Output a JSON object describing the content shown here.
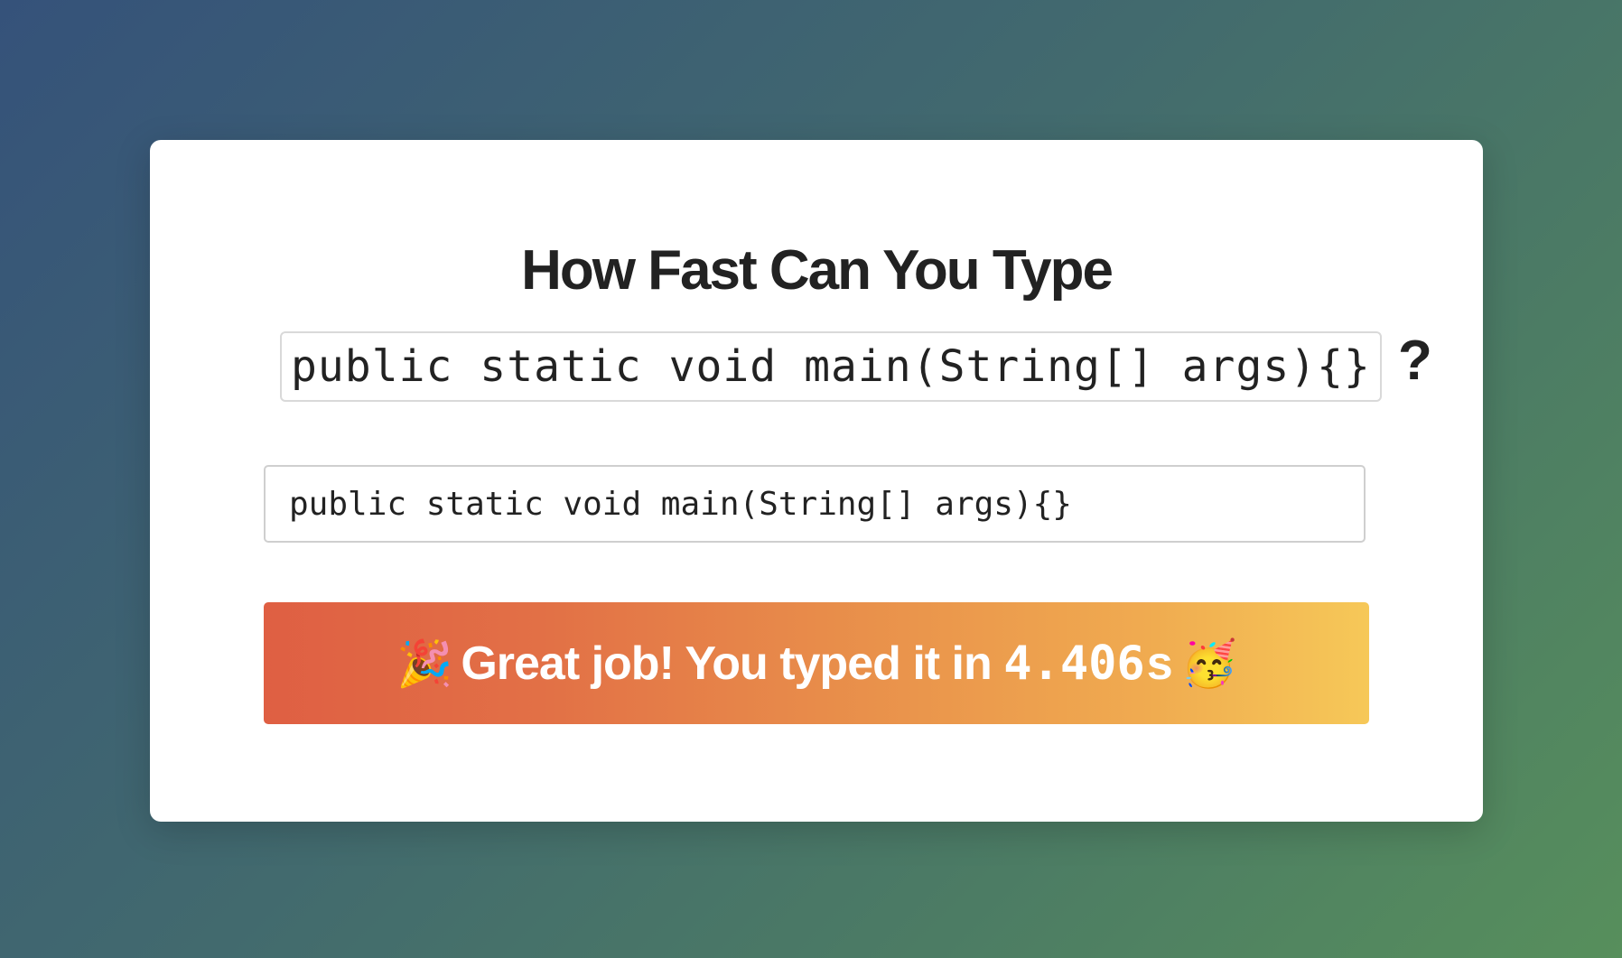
{
  "page": {
    "title": "How Fast Can You Type"
  },
  "challenge": {
    "target_text": "public static void main(String[] args){}",
    "question_mark": "?"
  },
  "input": {
    "value": "public static void main(String[] args){}"
  },
  "result": {
    "icon_left": "🎉",
    "message_prefix": "Great job! You typed it in",
    "time_value": "4.406",
    "time_unit": "s",
    "icon_right": "🥳"
  },
  "colors": {
    "banner_start": "#df5f43",
    "banner_end": "#f6c858",
    "background_start": "#35527a",
    "background_end": "#578f5c"
  }
}
